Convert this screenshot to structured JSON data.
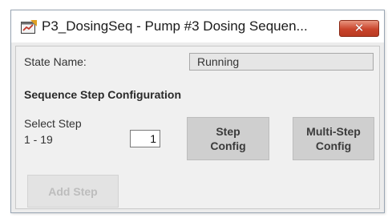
{
  "window": {
    "title": "P3_DosingSeq - Pump #3 Dosing Sequen...",
    "icon": "pump-dosing-app-icon",
    "close_icon": "close-icon",
    "close_label": "✕"
  },
  "state": {
    "label": "State Name:",
    "value": "Running"
  },
  "sequence": {
    "heading": "Sequence Step Configuration",
    "select_label_line1": "Select Step",
    "select_label_line2": "1 - 19",
    "step_value": "1",
    "step_config_line1": "Step",
    "step_config_line2": "Config",
    "multi_step_line1": "Multi-Step",
    "multi_step_line2": "Config",
    "add_step_label": "Add Step"
  },
  "colors": {
    "close_button": "#c9442b",
    "panel_background": "#f0f0f0",
    "button_background": "#cfcfcf",
    "disabled_text": "#bdbdbd"
  }
}
